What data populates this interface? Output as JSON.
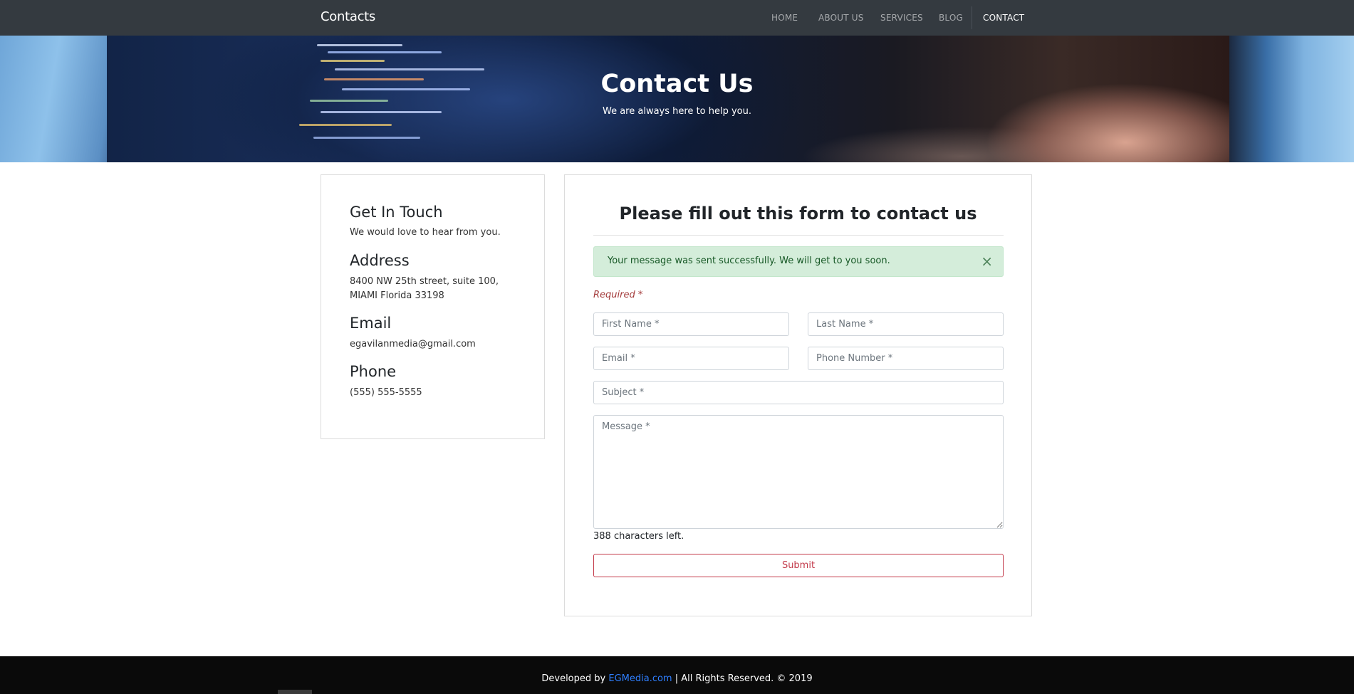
{
  "navbar": {
    "brand": "Contacts",
    "items": [
      {
        "label": "HOME"
      },
      {
        "label": "ABOUT US"
      },
      {
        "label": "SERVICES"
      },
      {
        "label": "BLOG"
      },
      {
        "label": "CONTACT",
        "active": true
      }
    ]
  },
  "hero": {
    "title": "Contact Us",
    "subtitle": "We are always here to help you."
  },
  "info": {
    "heading": "Get In Touch",
    "intro": "We would love to hear from you.",
    "address_heading": "Address",
    "address_line1": "8400 NW 25th street, suite 100,",
    "address_line2": "MIAMI Florida 33198",
    "email_heading": "Email",
    "email": "egavilanmedia@gmail.com",
    "phone_heading": "Phone",
    "phone": "(555) 555-5555"
  },
  "form": {
    "title": "Please fill out this form to contact us",
    "alert": "Your message was sent successfully. We will get to you soon.",
    "alert_close": "×",
    "required": "Required *",
    "first_name_placeholder": "First Name *",
    "last_name_placeholder": "Last Name *",
    "email_placeholder": "Email *",
    "phone_placeholder": "Phone Number *",
    "subject_placeholder": "Subject *",
    "message_placeholder": "Message *",
    "char_count": "388 characters left.",
    "submit": "Submit"
  },
  "footer": {
    "prefix": "Developed by ",
    "link": "EGMedia.com",
    "suffix": " | All Rights Reserved. © 2019"
  },
  "colors": {
    "navbar_bg": "#343a40",
    "alert_bg": "#d4edda",
    "submit_accent": "#c33a4a",
    "footer_bg": "#0a0a0a",
    "link": "#2f7fff"
  }
}
